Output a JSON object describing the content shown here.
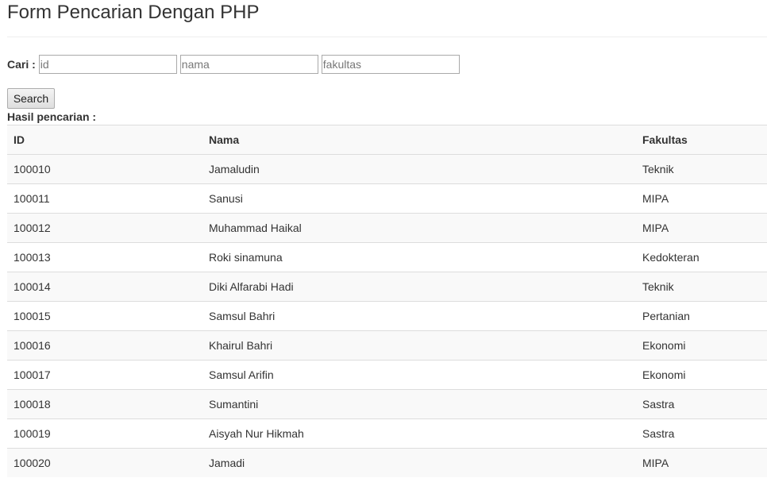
{
  "page": {
    "title": "Form Pencarian Dengan PHP"
  },
  "search": {
    "label": "Cari :",
    "id_placeholder": "id",
    "nama_placeholder": "nama",
    "fakultas_placeholder": "fakultas",
    "id_value": "",
    "nama_value": "",
    "fakultas_value": "",
    "button_label": "Search"
  },
  "results": {
    "label": "Hasil pencarian :",
    "columns": [
      "ID",
      "Nama",
      "Fakultas"
    ],
    "rows": [
      {
        "id": "100010",
        "nama": "Jamaludin",
        "fakultas": "Teknik"
      },
      {
        "id": "100011",
        "nama": "Sanusi",
        "fakultas": "MIPA"
      },
      {
        "id": "100012",
        "nama": "Muhammad Haikal",
        "fakultas": "MIPA"
      },
      {
        "id": "100013",
        "nama": "Roki sinamuna",
        "fakultas": "Kedokteran"
      },
      {
        "id": "100014",
        "nama": "Diki Alfarabi Hadi",
        "fakultas": "Teknik"
      },
      {
        "id": "100015",
        "nama": "Samsul Bahri",
        "fakultas": "Pertanian"
      },
      {
        "id": "100016",
        "nama": "Khairul Bahri",
        "fakultas": "Ekonomi"
      },
      {
        "id": "100017",
        "nama": "Samsul Arifin",
        "fakultas": "Ekonomi"
      },
      {
        "id": "100018",
        "nama": "Sumantini",
        "fakultas": "Sastra"
      },
      {
        "id": "100019",
        "nama": "Aisyah Nur Hikmah",
        "fakultas": "Sastra"
      },
      {
        "id": "100020",
        "nama": "Jamadi",
        "fakultas": "MIPA"
      }
    ]
  }
}
